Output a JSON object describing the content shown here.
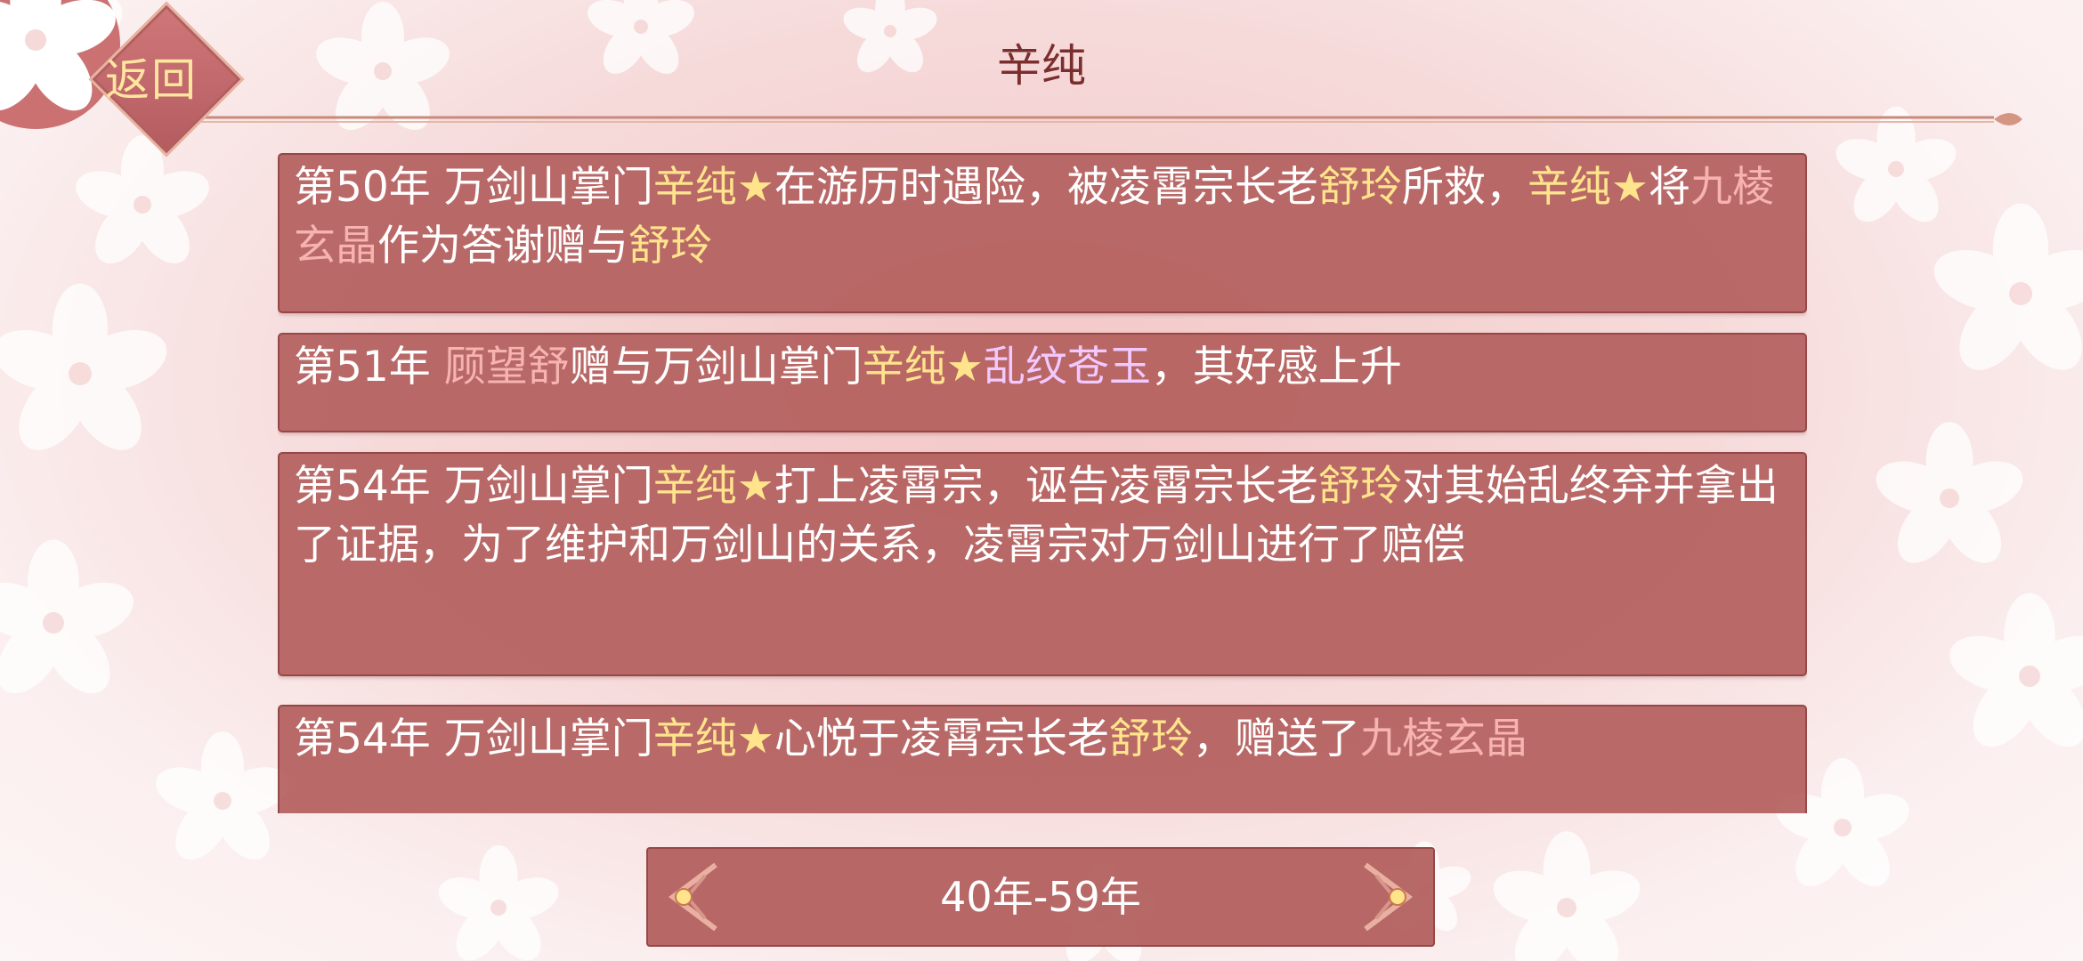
{
  "header": {
    "back_label": "返回",
    "title": "辛纯"
  },
  "events": [
    {
      "segments": [
        {
          "text": "第50年 万剑山掌门"
        },
        {
          "text": "辛纯★",
          "color": "gold"
        },
        {
          "text": "在游历时遇险，被凌霄宗长老"
        },
        {
          "text": "舒玲",
          "color": "gold"
        },
        {
          "text": "所救，"
        },
        {
          "text": "辛纯★",
          "color": "gold"
        },
        {
          "text": "将"
        },
        {
          "text": "九棱玄晶",
          "color": "pink"
        },
        {
          "text": "作为答谢赠与"
        },
        {
          "text": "舒玲",
          "color": "gold"
        }
      ]
    },
    {
      "segments": [
        {
          "text": "第51年 "
        },
        {
          "text": "顾望舒",
          "color": "pink"
        },
        {
          "text": "赠与万剑山掌门"
        },
        {
          "text": "辛纯★",
          "color": "gold"
        },
        {
          "text": "乱纹苍玉",
          "color": "lilac"
        },
        {
          "text": "，其好感上升"
        }
      ]
    },
    {
      "segments": [
        {
          "text": "第54年 万剑山掌门"
        },
        {
          "text": "辛纯★",
          "color": "gold"
        },
        {
          "text": "打上凌霄宗，诬告凌霄宗长老"
        },
        {
          "text": "舒玲",
          "color": "gold"
        },
        {
          "text": "对其始乱终弃并拿出了证据，为了维护和万剑山的关系，凌霄宗对万剑山进行了赔偿"
        }
      ]
    },
    {
      "segments": [
        {
          "text": "第54年 万剑山掌门"
        },
        {
          "text": "辛纯★",
          "color": "gold"
        },
        {
          "text": "心悦于凌霄宗长老"
        },
        {
          "text": "舒玲",
          "color": "gold"
        },
        {
          "text": "，赠送了"
        },
        {
          "text": "九棱玄晶",
          "color": "pink"
        }
      ]
    }
  ],
  "pager": {
    "range_label": "40年-59年",
    "prev_icon": "left-ornament-arrow-icon",
    "next_icon": "right-ornament-arrow-icon"
  },
  "colors": {
    "card_bg": "#b15c5a",
    "highlight_gold": "#ffe48c",
    "highlight_pink": "#f6b3b0",
    "highlight_lilac": "#f2c8ff",
    "title": "#7a2e2e"
  }
}
